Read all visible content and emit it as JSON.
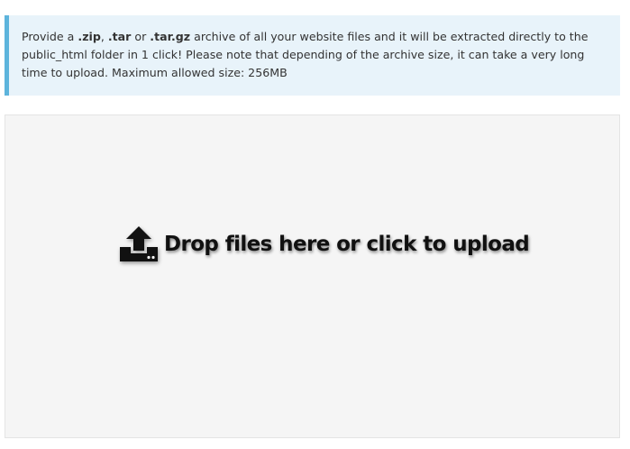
{
  "notice": {
    "prefix": "Provide a ",
    "ext_zip": ".zip",
    "sep1": ", ",
    "ext_tar": ".tar",
    "sep2": " or ",
    "ext_targz": ".tar.gz",
    "rest": " archive of all your website files and it will be extracted directly to the public_html folder in 1 click! Please note that depending of the archive size, it can take a very long time to upload. Maximum allowed size: 256MB"
  },
  "dropzone": {
    "message": "Drop files here or click to upload",
    "icon": "upload-icon"
  },
  "colors": {
    "notice_bg": "#e8f3fa",
    "notice_border": "#5db4dc",
    "dropzone_bg": "#f5f5f5"
  }
}
